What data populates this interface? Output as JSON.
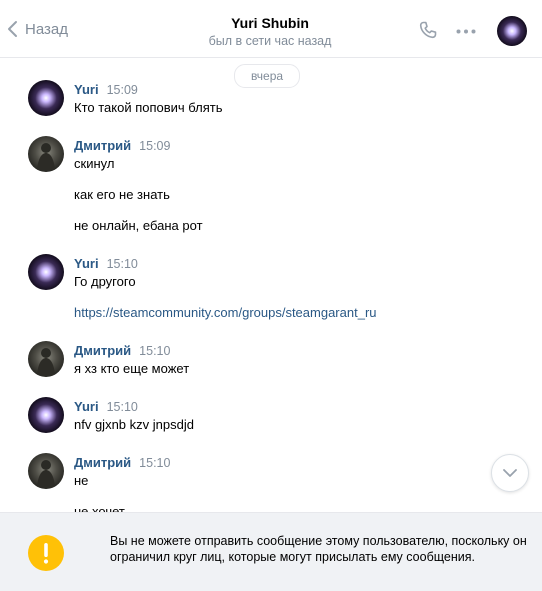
{
  "header": {
    "back_label": "Назад",
    "title": "Yuri Shubin",
    "subtitle": "был в сети час назад"
  },
  "chat": {
    "date_separator": "вчера",
    "messages": [
      {
        "author": "Yuri",
        "time": "15:09",
        "lines": [
          "Кто такой попович блять"
        ]
      },
      {
        "author": "Дмитрий",
        "time": "15:09",
        "lines": [
          "скинул",
          "как его не знать",
          "не онлайн, ебана рот"
        ]
      },
      {
        "author": "Yuri",
        "time": "15:10",
        "lines": [
          "Го другого",
          "https://steamcommunity.com/groups/steamgarant_ru"
        ]
      },
      {
        "author": "Дмитрий",
        "time": "15:10",
        "lines": [
          "я хз кто еще может"
        ]
      },
      {
        "author": "Yuri",
        "time": "15:10",
        "lines": [
          "nfv gjxnb kzv jnpsdjd"
        ]
      },
      {
        "author": "Дмитрий",
        "time": "15:10",
        "lines": [
          "не",
          "не хочет"
        ]
      }
    ]
  },
  "notice": {
    "text": "Вы не можете отправить сообщение этому пользователю, поскольку он ограничил круг лиц, которые могут присылать ему сообщения.",
    "icon": "exclamation-icon",
    "color": "#ffc107"
  },
  "colors": {
    "link": "#2a5885",
    "muted": "#818c99"
  }
}
